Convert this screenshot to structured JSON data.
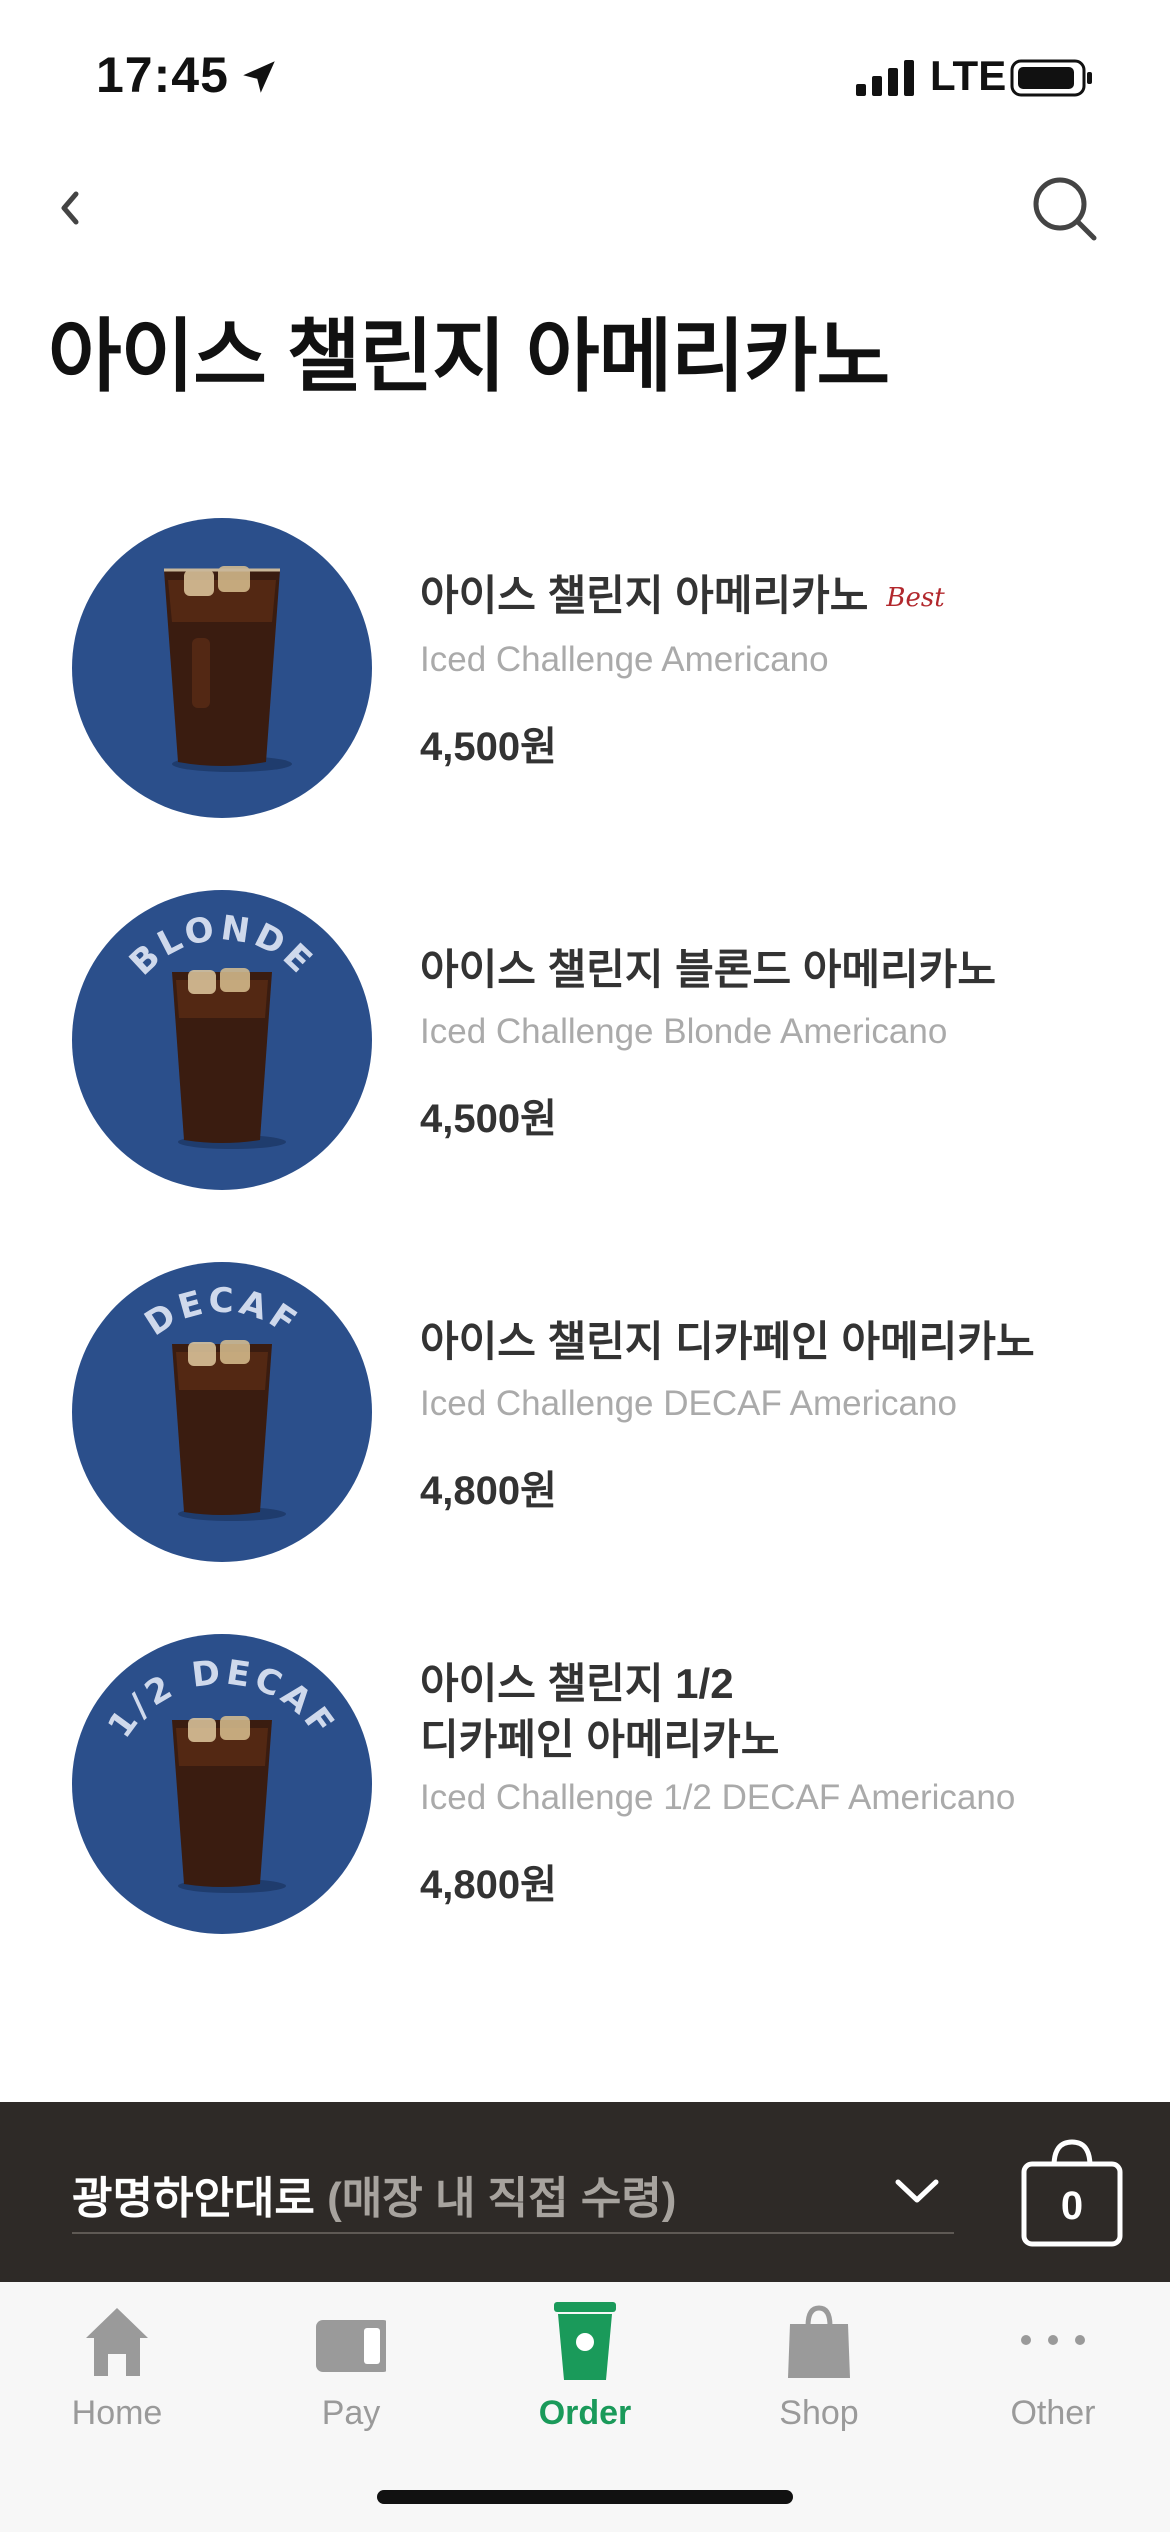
{
  "status": {
    "time": "17:45",
    "network": "LTE"
  },
  "page": {
    "title": "아이스 챌린지 아메리카노"
  },
  "products": [
    {
      "name_ko": "아이스 챌린지 아메리카노",
      "badge": "Best",
      "name_en": "Iced Challenge Americano",
      "price": "4,500원",
      "ring_label": ""
    },
    {
      "name_ko": "아이스 챌린지 블론드 아메리카노",
      "badge": "",
      "name_en": "Iced Challenge Blonde Americano",
      "price": "4,500원",
      "ring_label": "BLONDE"
    },
    {
      "name_ko": "아이스 챌린지 디카페인 아메리카노",
      "badge": "",
      "name_en": "Iced Challenge DECAF Americano",
      "price": "4,800원",
      "ring_label": "DECAF"
    },
    {
      "name_ko_line1": "아이스 챌린지 1/2",
      "name_ko_line2": "디카페인 아메리카노",
      "badge": "",
      "name_en": "Iced Challenge 1/2 DECAF Americano",
      "price": "4,800원",
      "ring_label": "1/2 DECAF"
    }
  ],
  "store": {
    "name": "광명하안대로",
    "pickup": "(매장 내 직접 수령)",
    "cart_count": "0"
  },
  "tabs": [
    {
      "label": "Home",
      "icon": "home-icon",
      "active": false
    },
    {
      "label": "Pay",
      "icon": "card-icon",
      "active": false
    },
    {
      "label": "Order",
      "icon": "cup-icon",
      "active": true
    },
    {
      "label": "Shop",
      "icon": "bag-icon",
      "active": false
    },
    {
      "label": "Other",
      "icon": "more-icon",
      "active": false
    }
  ],
  "colors": {
    "thumb_bg": "#2b4f8b",
    "best": "#b2282d",
    "active_tab": "#1a9a5a",
    "store_bar": "#2e2a27"
  }
}
